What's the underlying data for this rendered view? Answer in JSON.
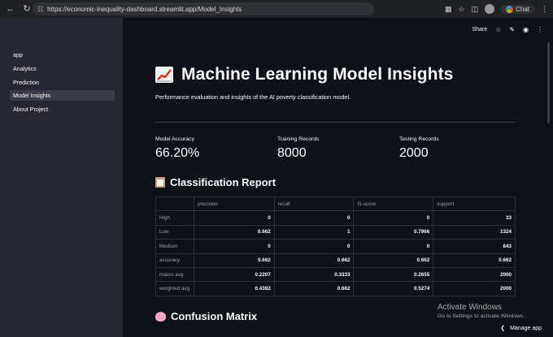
{
  "browser": {
    "url": "https://economic-inequality-dashboard.streamlit.app/Model_Insights",
    "chat_label": "Chat"
  },
  "sidebar": {
    "items": [
      {
        "label": "app",
        "active": false
      },
      {
        "label": "Analytics",
        "active": false
      },
      {
        "label": "Prediction",
        "active": false
      },
      {
        "label": "Model Insights",
        "active": true
      },
      {
        "label": "About Project",
        "active": false
      }
    ]
  },
  "toolbar": {
    "share_label": "Share"
  },
  "page": {
    "title": "Machine Learning Model Insights",
    "subtitle": "Performance evaluation and insights of the AI poverty classification model."
  },
  "metrics": [
    {
      "label": "Model Accuracy",
      "value": "66.20%"
    },
    {
      "label": "Training Records",
      "value": "8000"
    },
    {
      "label": "Testing Records",
      "value": "2000"
    }
  ],
  "classification_report": {
    "heading": "Classification Report",
    "columns": [
      "",
      "precision",
      "recall",
      "f1-score",
      "support"
    ],
    "rows": [
      {
        "label": "High",
        "values": [
          "0",
          "0",
          "0",
          "33"
        ]
      },
      {
        "label": "Low",
        "values": [
          "0.662",
          "1",
          "0.7966",
          "1324"
        ]
      },
      {
        "label": "Medium",
        "values": [
          "0",
          "0",
          "0",
          "643"
        ]
      },
      {
        "label": "accuracy",
        "values": [
          "0.662",
          "0.662",
          "0.662",
          "0.662"
        ]
      },
      {
        "label": "macro avg",
        "values": [
          "0.2207",
          "0.3333",
          "0.2655",
          "2000"
        ]
      },
      {
        "label": "weighted avg",
        "values": [
          "0.4382",
          "0.662",
          "0.5274",
          "2000"
        ]
      }
    ]
  },
  "confusion_matrix": {
    "heading": "Confusion Matrix"
  },
  "watermark": {
    "title": "Activate Windows",
    "subtitle": "Go to Settings to activate Windows."
  },
  "manage_app_label": "Manage app",
  "icons": {
    "back": "back-arrow-icon",
    "reload": "reload-icon",
    "site_info": "site-info-icon",
    "star": "star-icon",
    "edit": "pencil-icon",
    "github": "github-icon",
    "menu": "kebab-menu-icon",
    "chart": "chart-increasing-icon",
    "clipboard": "clipboard-icon",
    "brain": "brain-icon"
  }
}
